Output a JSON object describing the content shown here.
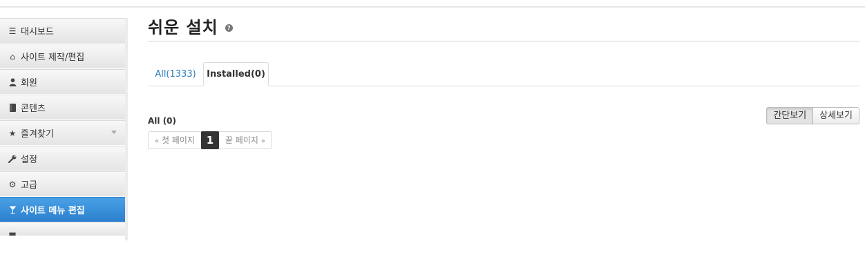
{
  "sidebar": {
    "items": [
      {
        "label": "대시보드",
        "icon": "list-icon"
      },
      {
        "label": "사이트 제작/편집",
        "icon": "home-icon"
      },
      {
        "label": "회원",
        "icon": "user-icon"
      },
      {
        "label": "콘텐츠",
        "icon": "book-icon"
      },
      {
        "label": "즐겨찾기",
        "icon": "star-icon"
      },
      {
        "label": "설정",
        "icon": "wrench-icon"
      },
      {
        "label": "고급",
        "icon": "gear-icon"
      },
      {
        "label": "사이트 메뉴 편집",
        "icon": "glass-icon"
      }
    ],
    "active_color": "#3a8fdb"
  },
  "main": {
    "title": "쉬운 설치",
    "tabs": [
      {
        "label": "All(1333)"
      },
      {
        "label": "Installed(0)"
      }
    ],
    "count_label": "All (0)",
    "pagination": {
      "first": "첫 페이지",
      "current": "1",
      "last": "끝 페이지"
    },
    "view_toggle": {
      "simple": "간단보기",
      "detail": "상세보기"
    }
  }
}
